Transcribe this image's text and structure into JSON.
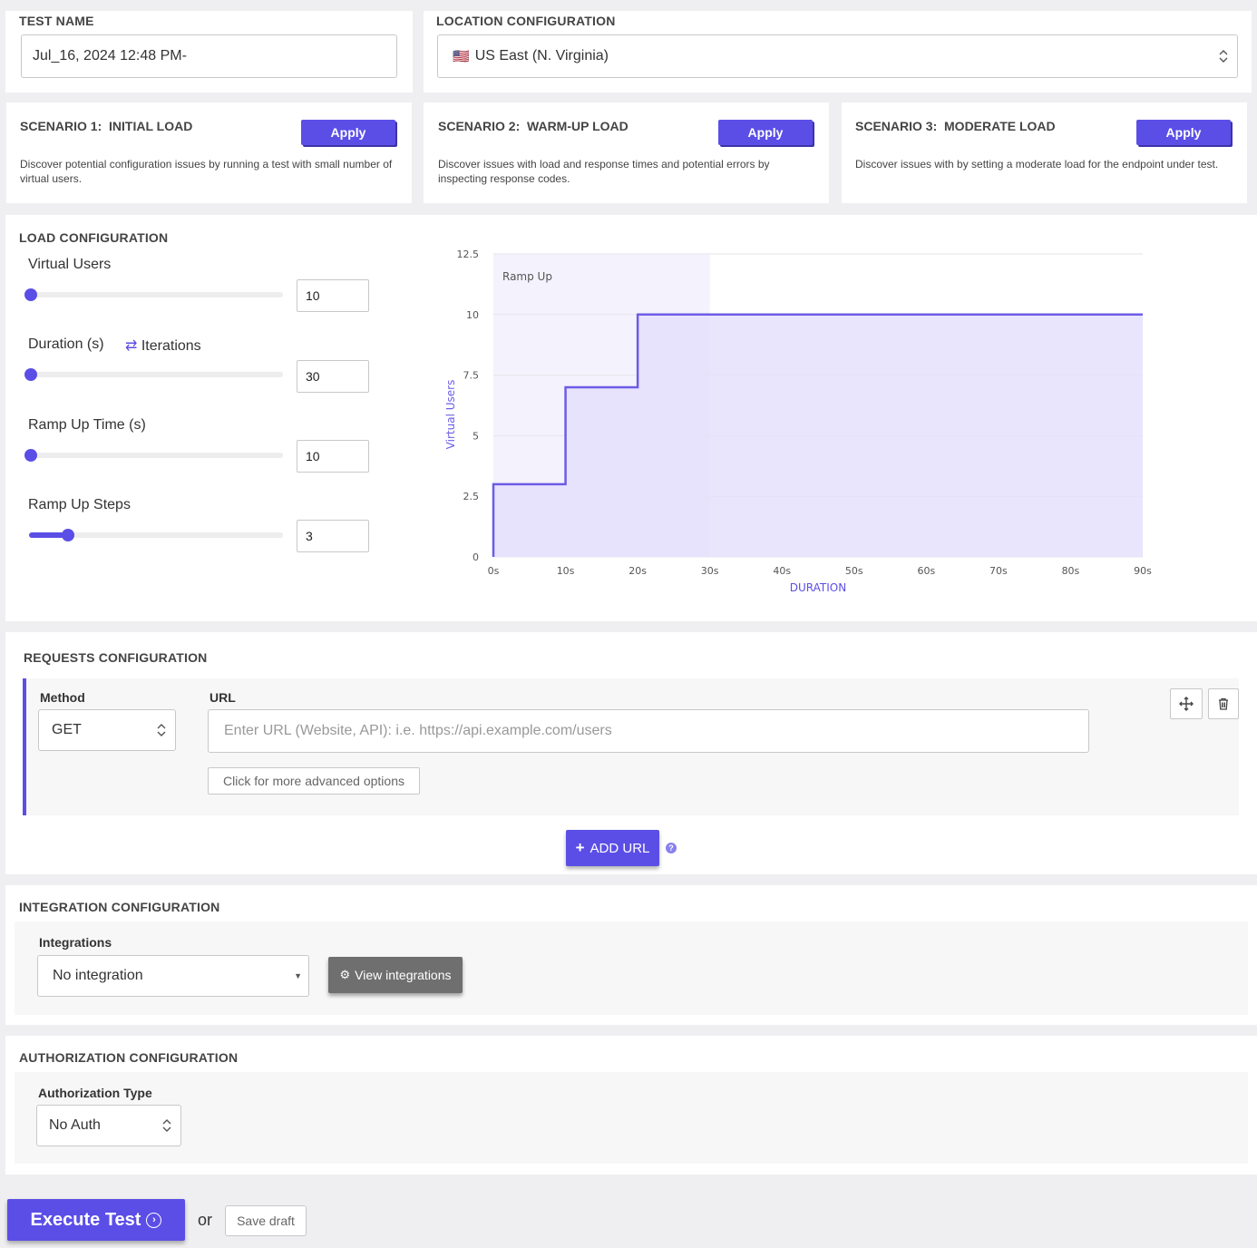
{
  "test_name": {
    "label": "TEST NAME",
    "value": "Jul_16, 2024 12:48 PM-"
  },
  "location": {
    "label": "LOCATION CONFIGURATION",
    "flag": "🇺🇸",
    "value": "US East (N. Virginia)"
  },
  "scenarios": [
    {
      "number": "SCENARIO 1:",
      "name": "INITIAL LOAD",
      "apply": "Apply",
      "line1": "Discover potential configuration issues by running a test with small number of",
      "line2": "virtual users."
    },
    {
      "number": "SCENARIO 2:",
      "name": "WARM-UP LOAD",
      "apply": "Apply",
      "line1": "Discover issues with load and response times and potential errors by",
      "line2": "inspecting response codes."
    },
    {
      "number": "SCENARIO 3:",
      "name": "MODERATE LOAD",
      "apply": "Apply",
      "line1": "Discover issues with by setting a moderate load for the endpoint under test.",
      "line2": ""
    }
  ],
  "load": {
    "title": "LOAD CONFIGURATION",
    "virtual_users": {
      "label": "Virtual Users",
      "value": "10",
      "level": 0.0
    },
    "duration": {
      "label": "Duration (s)",
      "toggle": "Iterations",
      "value": "30",
      "level": 0.0
    },
    "ramp_time": {
      "label": "Ramp Up Time (s)",
      "value": "10",
      "level": 0.0
    },
    "ramp_steps": {
      "label": "Ramp Up Steps",
      "value": "3",
      "level": 0.14
    }
  },
  "chart_data": {
    "type": "area",
    "title": "",
    "xlabel": "DURATION",
    "ylabel": "Virtual Users",
    "annotation": "Ramp Up",
    "ramp_region": [
      0,
      30
    ],
    "x_ticks": [
      "0s",
      "10s",
      "20s",
      "30s",
      "40s",
      "50s",
      "60s",
      "70s",
      "80s",
      "90s"
    ],
    "y_ticks": [
      "0",
      "2.5",
      "5",
      "7.5",
      "10",
      "12.5"
    ],
    "xlim": [
      0,
      90
    ],
    "ylim": [
      0,
      12.5
    ],
    "series": [
      {
        "x": [
          0,
          0,
          10,
          10,
          20,
          20,
          90
        ],
        "y": [
          0,
          3,
          3,
          7,
          7,
          10,
          10
        ]
      }
    ],
    "colors": {
      "line": "#6c5ce7",
      "fill": "#e4e0fb",
      "ramp": "#f4f2fd"
    }
  },
  "requests": {
    "title": "REQUESTS CONFIGURATION",
    "method_label": "Method",
    "method_value": "GET",
    "url_label": "URL",
    "url_placeholder": "Enter URL (Website, API): i.e. https://api.example.com/users",
    "advanced": "Click for more advanced options",
    "add_url": "ADD URL"
  },
  "integration": {
    "title": "INTEGRATION CONFIGURATION",
    "label": "Integrations",
    "value": "No integration",
    "view": "View integrations"
  },
  "authorization": {
    "title": "AUTHORIZATION CONFIGURATION",
    "label": "Authorization Type",
    "value": "No Auth"
  },
  "footer": {
    "execute": "Execute Test",
    "or": "or",
    "save": "Save draft"
  }
}
